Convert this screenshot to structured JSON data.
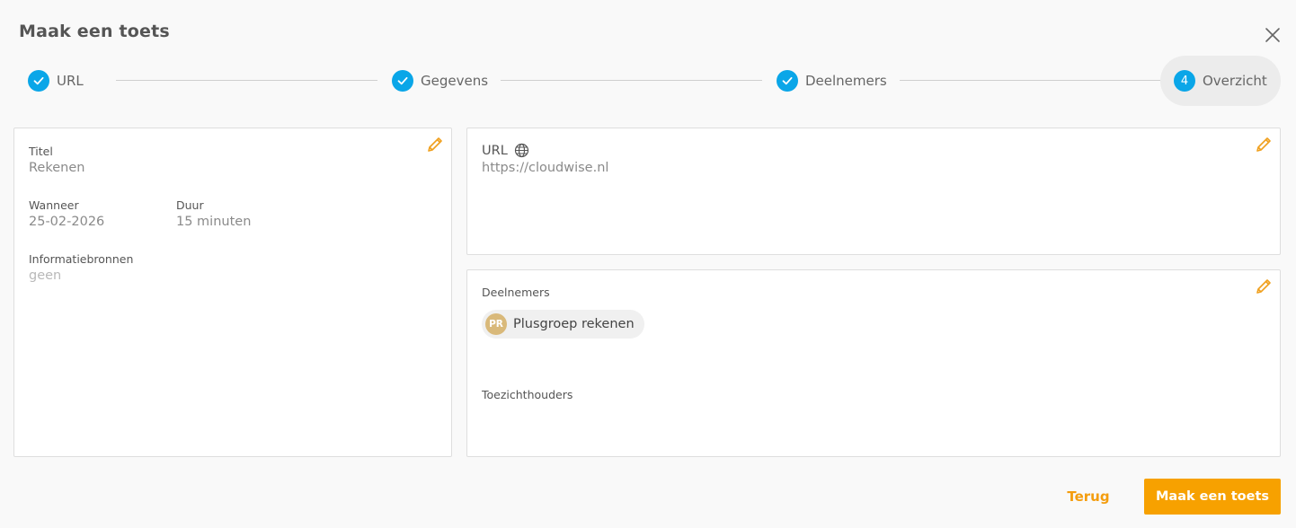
{
  "dialog": {
    "title": "Maak een toets",
    "close_icon": "close-icon"
  },
  "stepper": {
    "steps": [
      {
        "label": "URL",
        "status": "done"
      },
      {
        "label": "Gegevens",
        "status": "done"
      },
      {
        "label": "Deelnemers",
        "status": "done"
      },
      {
        "label": "Overzicht",
        "status": "active",
        "number": "4"
      }
    ],
    "accent_color": "#0aa6e8"
  },
  "details": {
    "title_label": "Titel",
    "title_value": "Rekenen",
    "when_label": "Wanneer",
    "when_value": "25-02-2026",
    "duration_label": "Duur",
    "duration_value": "15 minuten",
    "sources_label": "Informatiebronnen",
    "sources_value": "geen"
  },
  "url_card": {
    "label": "URL",
    "icon": "globe-icon",
    "value": "https://cloudwise.nl"
  },
  "participants": {
    "label": "Deelnemers",
    "chips": [
      {
        "initials": "PR",
        "name": "Plusgroep rekenen",
        "avatar_color": "#d9b97a"
      }
    ],
    "supervisors_label": "Toezichthouders"
  },
  "footer": {
    "back_label": "Terug",
    "submit_label": "Maak een toets",
    "primary_color": "#f7a100"
  },
  "edit_icon_color": "#f0a01e"
}
